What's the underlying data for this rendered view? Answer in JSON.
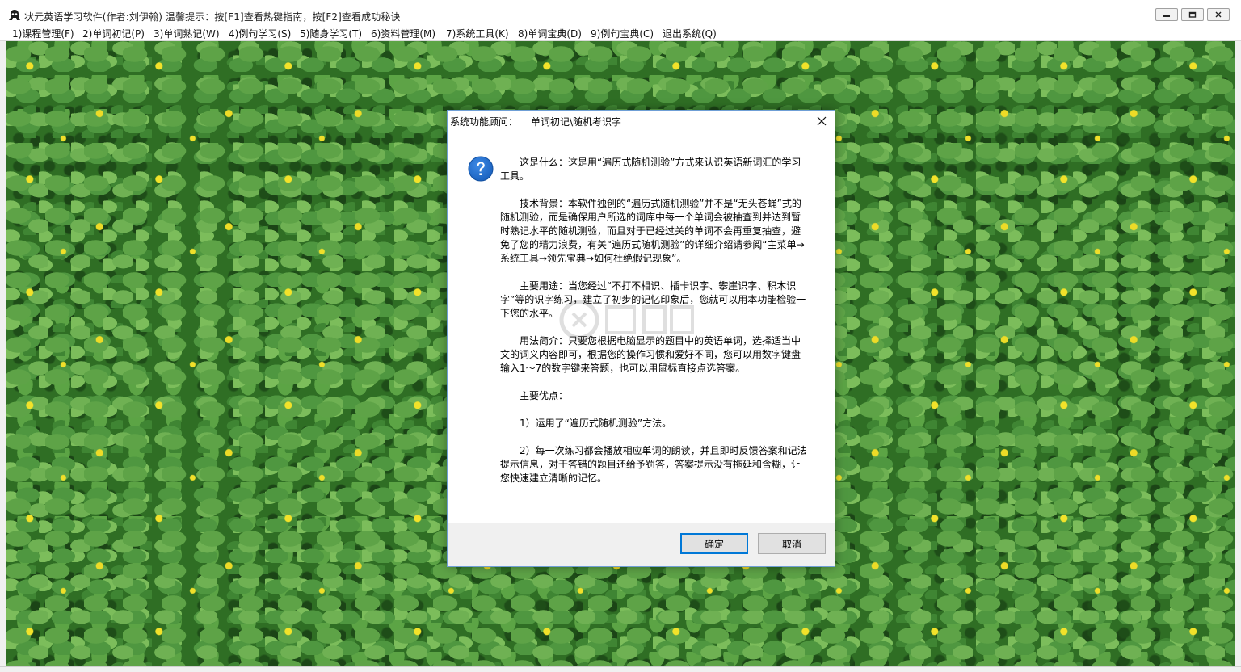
{
  "window": {
    "title": "状元英语学习软件(作者:刘伊翰)  温馨提示：按[F1]查看热键指南，按[F2]查看成功秘诀"
  },
  "menu": {
    "items": [
      {
        "label": "1)课程管理(F)"
      },
      {
        "label": "2)单词初记(P)"
      },
      {
        "label": "3)单词熟记(W)"
      },
      {
        "label": "4)例句学习(S)"
      },
      {
        "label": "5)随身学习(T)"
      },
      {
        "label": "6)资料管理(M)"
      },
      {
        "label": "7)系统工具(K)"
      },
      {
        "label": "8)单词宝典(D)"
      },
      {
        "label": "9)例句宝典(C)"
      },
      {
        "label": "退出系统(Q)"
      }
    ]
  },
  "dialog": {
    "title_prefix": "系统功能顾问：",
    "title_path": "单词初记\\随机考识字",
    "icon": "question-icon",
    "paragraphs": [
      "这是什么：这是用“遍历式随机测验”方式来认识英语新词汇的学习工具。",
      "技术背景：本软件独创的“遍历式随机测验”并不是“无头苍蝇”式的随机测验，而是确保用户所选的词库中每一个单词会被抽查到并达到暂时熟记水平的随机测验，而且对于已经过关的单词不会再重复抽查，避免了您的精力浪费，有关“遍历式随机测验”的详细介绍请参阅“主菜单→系统工具→领先宝典→如何杜绝假记现象”。",
      "主要用途：当您经过“不打不相识、插卡识字、攀崖识字、积木识字”等的识字练习，建立了初步的记忆印象后，您就可以用本功能检验一下您的水平。",
      "用法简介：只要您根据电脑显示的题目中的英语单词，选择适当中文的词义内容即可，根据您的操作习惯和爱好不同，您可以用数字键盘输入1～7的数字键来答题，也可以用鼠标直接点选答案。",
      "主要优点：",
      "1）运用了“遍历式随机测验”方法。",
      "2）每一次练习都会播放相应单词的朗读，并且即时反馈答案和记法提示信息，对于答错的题目还给予罚答，答案提示没有拖延和含糊，让您快速建立清晰的记忆。"
    ],
    "ok_label": "确定",
    "cancel_label": "取消"
  },
  "colors": {
    "dialog_border": "#6f9fd6",
    "default_button_border": "#0078d7",
    "icon_blue": "#1c63c0",
    "background_green": "#2f6e24",
    "flower_yellow": "#f2e22a"
  }
}
